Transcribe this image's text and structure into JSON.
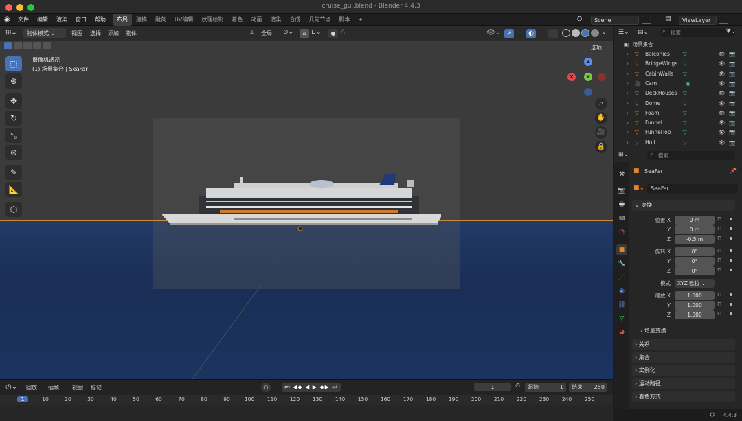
{
  "window": {
    "title": "cruise_gui.blend - Blender 4.4.3"
  },
  "menu": [
    "文件",
    "编辑",
    "渲染",
    "窗口",
    "帮助"
  ],
  "workspaces": [
    {
      "label": "布局",
      "active": true
    },
    {
      "label": "建模"
    },
    {
      "label": "雕刻"
    },
    {
      "label": "UV编辑"
    },
    {
      "label": "纹理绘制"
    },
    {
      "label": "着色"
    },
    {
      "label": "动画"
    },
    {
      "label": "渲染"
    },
    {
      "label": "合成"
    },
    {
      "label": "几何节点"
    },
    {
      "label": "脚本"
    },
    {
      "label": "+"
    }
  ],
  "scene": {
    "label": "Scene",
    "view_layer": "ViewLayer"
  },
  "viewport_header": {
    "mode": "物体模式",
    "menus": [
      "视图",
      "选择",
      "添加",
      "物体"
    ],
    "transform_orientation": "全局",
    "options": "选项"
  },
  "viewport": {
    "camera_label": "摄像机透视",
    "context_label": "(1) 场景集合 | SeaFar",
    "gizmo": {
      "z": "Z",
      "y": "Y",
      "x": "X"
    }
  },
  "timeline": {
    "menus": [
      "回放",
      "插帧",
      "视图",
      "标记"
    ],
    "current_frame": "1",
    "start_label": "起始",
    "start": "1",
    "end_label": "结束",
    "end": "250",
    "ticks": [
      "1",
      "10",
      "20",
      "30",
      "40",
      "50",
      "60",
      "70",
      "80",
      "90",
      "100",
      "110",
      "120",
      "130",
      "140",
      "150",
      "160",
      "170",
      "180",
      "190",
      "200",
      "210",
      "220",
      "230",
      "240",
      "250"
    ]
  },
  "outliner": {
    "search_placeholder": "搜索",
    "root": "场景集合",
    "items": [
      "Balconies",
      "BridgeWings",
      "CabinWalls",
      "Cam",
      "DeckHouses",
      "Dome",
      "Foam",
      "Funnel",
      "FunnelTop",
      "Hull"
    ]
  },
  "properties": {
    "search_placeholder": "搜索",
    "object_name": "SeaFar",
    "object_field": "SeaFar",
    "transform_section": "变换",
    "location_label": "位置 X",
    "location": [
      "0 m",
      "0 m",
      "-0.5 m"
    ],
    "rotation_label": "旋转 X",
    "rotation": [
      "0°",
      "0°",
      "0°"
    ],
    "mode_label": "模式",
    "mode_value": "XYZ 欧拉",
    "scale_label": "缩放 X",
    "scale": [
      "1.000",
      "1.000",
      "1.000"
    ],
    "axis_y": "Y",
    "axis_z": "Z",
    "delta_section": "增量变换",
    "sections": [
      "关系",
      "集合",
      "实例化",
      "运动路径",
      "着色方式"
    ]
  },
  "status": {
    "version": "4.4.3"
  },
  "colors": {
    "accent": "#4772b3",
    "object_orange": "#e0872c",
    "sea": "#1c3360",
    "active_frame": "#4772b3"
  }
}
